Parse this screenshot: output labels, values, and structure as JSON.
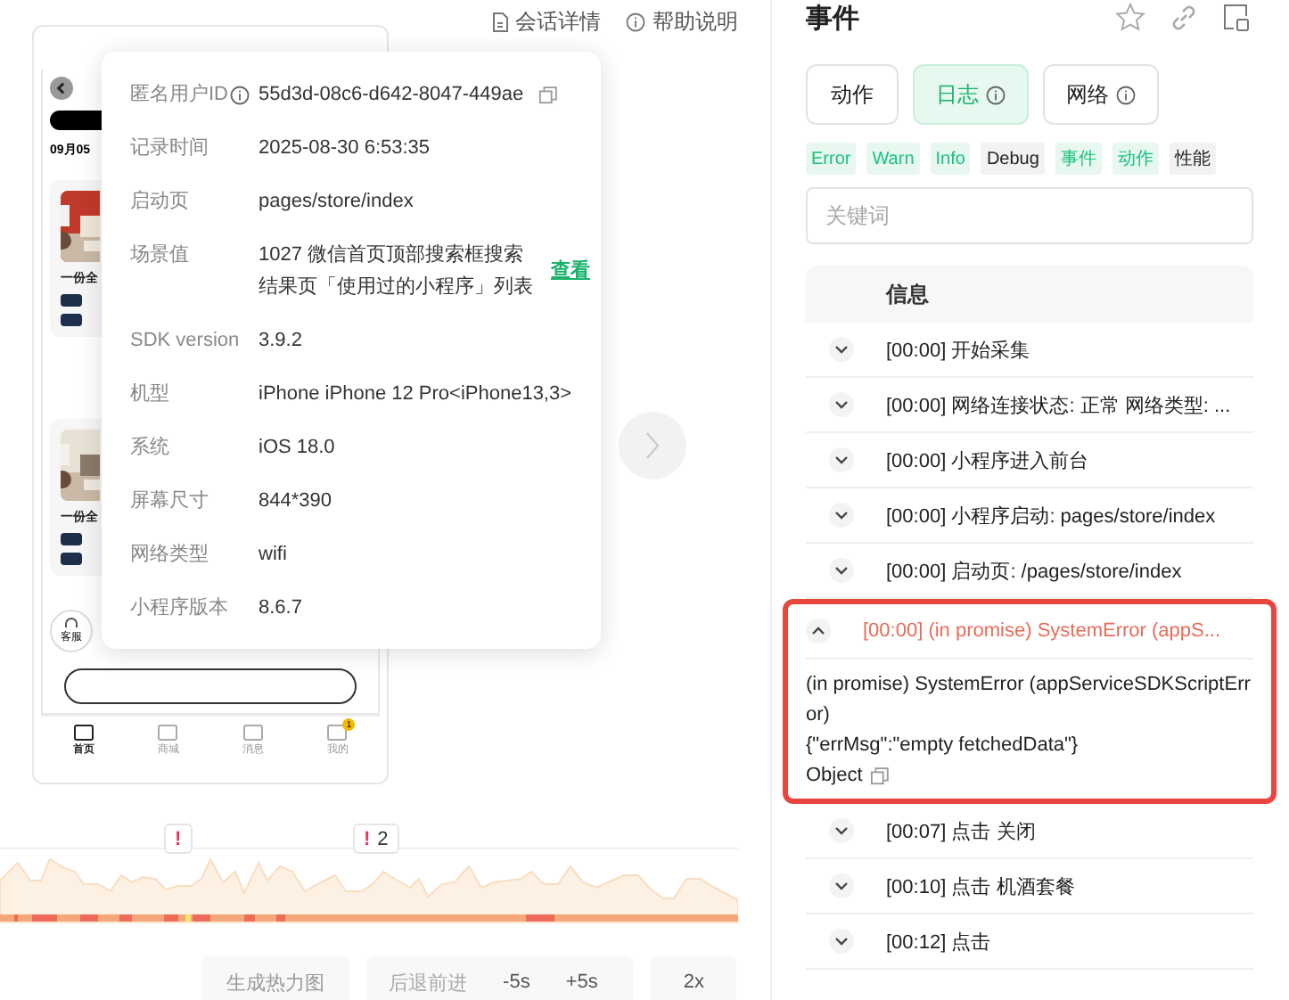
{
  "top_links": [
    {
      "kind": "doc",
      "label": "会话详情"
    },
    {
      "kind": "help",
      "label": "帮助说明"
    }
  ],
  "phone": {
    "date": "09月05",
    "card_titles": [
      "一份全",
      "一份全"
    ],
    "service_label": "客服",
    "nav": [
      {
        "label": "首页",
        "selected": true
      },
      {
        "label": "商城",
        "selected": false
      },
      {
        "label": "消息",
        "selected": false
      },
      {
        "label": "我的",
        "selected": false,
        "badge": "1"
      }
    ]
  },
  "session_popover": {
    "rows": [
      {
        "label": "匿名用户ID",
        "value": "55d3d-08c6-d642-8047-449ae",
        "info": true,
        "copy": true
      },
      {
        "label": "记录时间",
        "value": "2025-08-30 6:53:35"
      },
      {
        "label": "启动页",
        "value": "pages/store/index"
      },
      {
        "label": "场景值",
        "value": "1027 微信首页顶部搜索框搜索结果页「使用过的小程序」列表",
        "link": "查看"
      },
      {
        "label": "SDK version",
        "value": "3.9.2"
      },
      {
        "label": "机型",
        "value": "iPhone iPhone 12 Pro<iPhone13,3>"
      },
      {
        "label": "系统",
        "value": "iOS 18.0"
      },
      {
        "label": "屏幕尺寸",
        "value": "844*390"
      },
      {
        "label": "网络类型",
        "value": "wifi"
      },
      {
        "label": "小程序版本",
        "value": "8.6.7"
      }
    ]
  },
  "timeline": {
    "markers": [
      {
        "glyph": "!"
      },
      {
        "glyph": "!",
        "count": "2"
      }
    ]
  },
  "controls": {
    "heatmap": "生成热力图",
    "step_label": "后退前进",
    "back": "-5s",
    "forward": "+5s",
    "speed": "2x"
  },
  "events_panel": {
    "title": "事件",
    "tabs": [
      {
        "label": "动作",
        "selected": false,
        "info": false
      },
      {
        "label": "日志",
        "selected": true,
        "info": true
      },
      {
        "label": "网络",
        "selected": false,
        "info": true
      }
    ],
    "filters": [
      {
        "label": "Error",
        "selected": true
      },
      {
        "label": "Warn",
        "selected": true
      },
      {
        "label": "Info",
        "selected": true
      },
      {
        "label": "Debug",
        "selected": false
      },
      {
        "label": "事件",
        "selected": true
      },
      {
        "label": "动作",
        "selected": true
      },
      {
        "label": "性能",
        "selected": false
      }
    ],
    "search": {
      "placeholder": "关键词"
    },
    "table": {
      "columns": [
        "信息"
      ],
      "rows": [
        {
          "kind": "info",
          "text": "[00:00] 开始采集",
          "expanded": false
        },
        {
          "kind": "info",
          "text": "[00:00] 网络连接状态: 正常 网络类型: ...",
          "expanded": false
        },
        {
          "kind": "info",
          "text": "[00:00] 小程序进入前台",
          "expanded": false
        },
        {
          "kind": "info",
          "text": "[00:00] 小程序启动: pages/store/index",
          "expanded": false
        },
        {
          "kind": "info",
          "text": "[00:00] 启动页: /pages/store/index",
          "expanded": false
        },
        {
          "kind": "error",
          "text": "[00:00] (in promise) SystemError (appS...",
          "expanded": true,
          "details": [
            "(in promise) SystemError (appServiceSDKScriptError)",
            "{\"errMsg\":\"empty fetchedData\"}"
          ],
          "object_label": "Object"
        },
        {
          "kind": "info",
          "text": "[00:07] 点击 关闭",
          "expanded": false
        },
        {
          "kind": "info",
          "text": "[00:10] 点击 机酒套餐",
          "expanded": false
        },
        {
          "kind": "info",
          "text": "[00:12] 点击",
          "expanded": false
        }
      ]
    }
  }
}
